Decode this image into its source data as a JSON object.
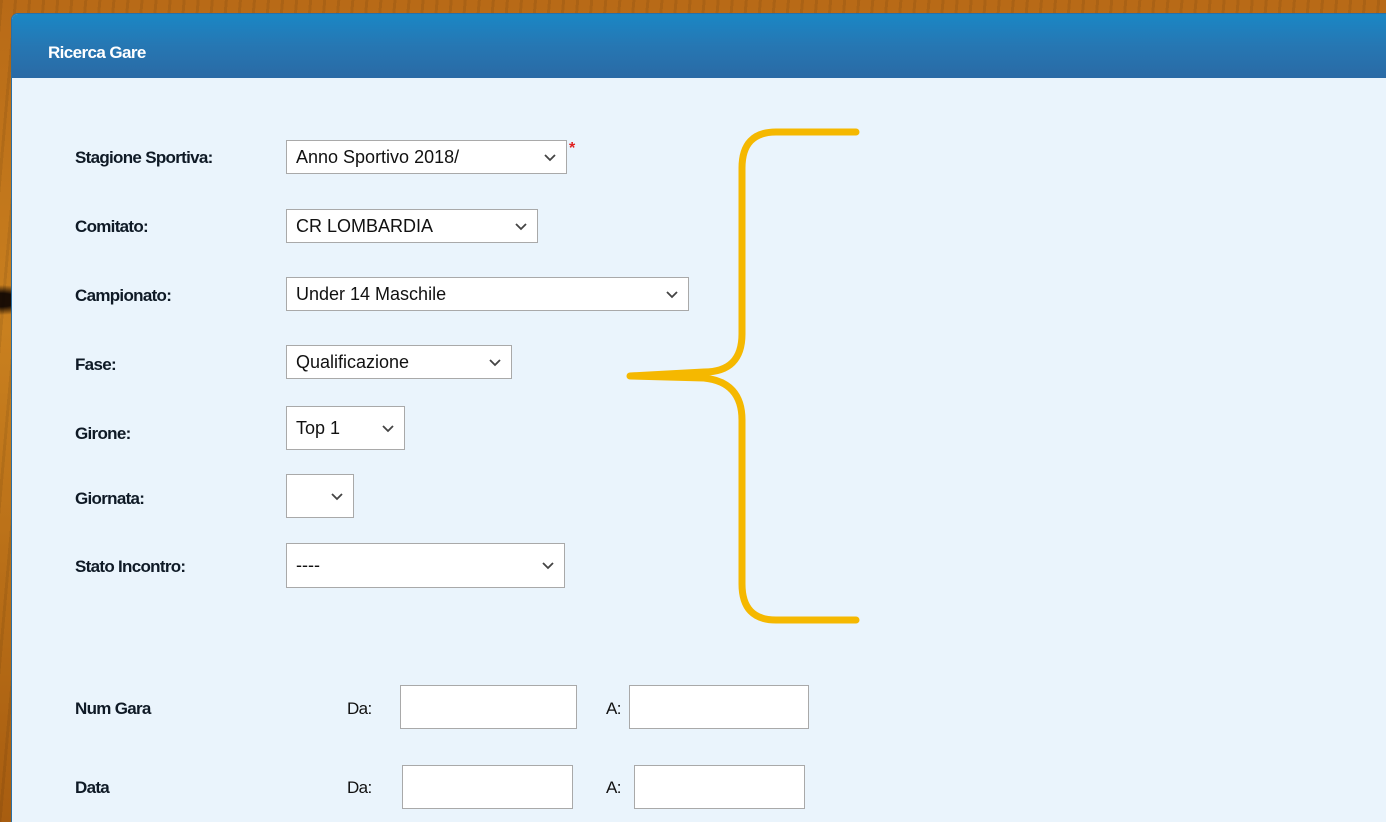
{
  "panel": {
    "title": "Ricerca Gare"
  },
  "form": {
    "stagione": {
      "label": "Stagione Sportiva:",
      "value": "Anno Sportivo 2018/",
      "required_mark": "*"
    },
    "comitato": {
      "label": "Comitato:",
      "value": "CR LOMBARDIA"
    },
    "campionato": {
      "label": "Campionato:",
      "value": "Under 14 Maschile"
    },
    "fase": {
      "label": "Fase:",
      "value": "Qualificazione"
    },
    "girone": {
      "label": "Girone:",
      "value": "Top 1"
    },
    "giornata": {
      "label": "Giornata:",
      "value": ""
    },
    "stato": {
      "label": "Stato Incontro:",
      "value": "----"
    },
    "num_gara": {
      "label": "Num Gara",
      "from_label": "Da:",
      "to_label": "A:",
      "from_value": "",
      "to_value": ""
    },
    "data": {
      "label": "Data",
      "from_label": "Da:",
      "to_label": "A:",
      "from_value": "",
      "to_value": ""
    }
  },
  "colors": {
    "header": "#2677b3",
    "panel_bg": "#eaf4fc",
    "brace": "#f5b800",
    "required": "#e02020"
  },
  "icons": {
    "dropdown": "chevron-down-icon",
    "annotation": "curly-brace-annotation"
  }
}
